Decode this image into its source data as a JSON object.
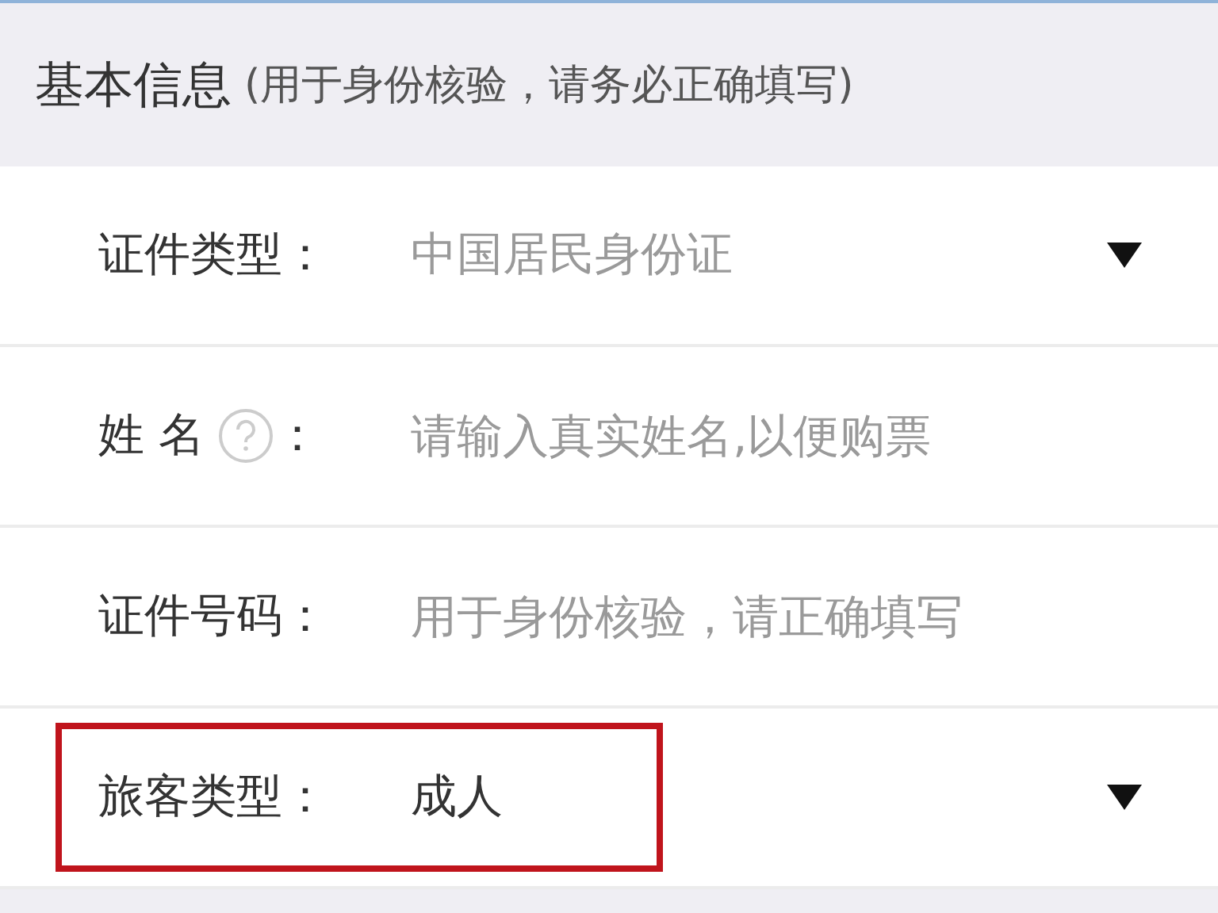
{
  "section": {
    "title": "基本信息",
    "note": "(用于身份核验，请务必正确填写)"
  },
  "fields": [
    {
      "kind": "select",
      "label": "证件类型",
      "help": false,
      "colon": "：",
      "placeholder": "中国居民身份证",
      "highlighted": false
    },
    {
      "kind": "input",
      "label": "姓 名",
      "help": true,
      "colon": "：",
      "placeholder": "请输入真实姓名,以便购票",
      "highlighted": false
    },
    {
      "kind": "input",
      "label": "证件号码",
      "help": false,
      "colon": "：",
      "placeholder": "用于身份核验，请正确填写",
      "highlighted": false
    },
    {
      "kind": "select",
      "label": "旅客类型",
      "help": false,
      "colon": "：",
      "value": "成人",
      "highlighted": true
    }
  ]
}
